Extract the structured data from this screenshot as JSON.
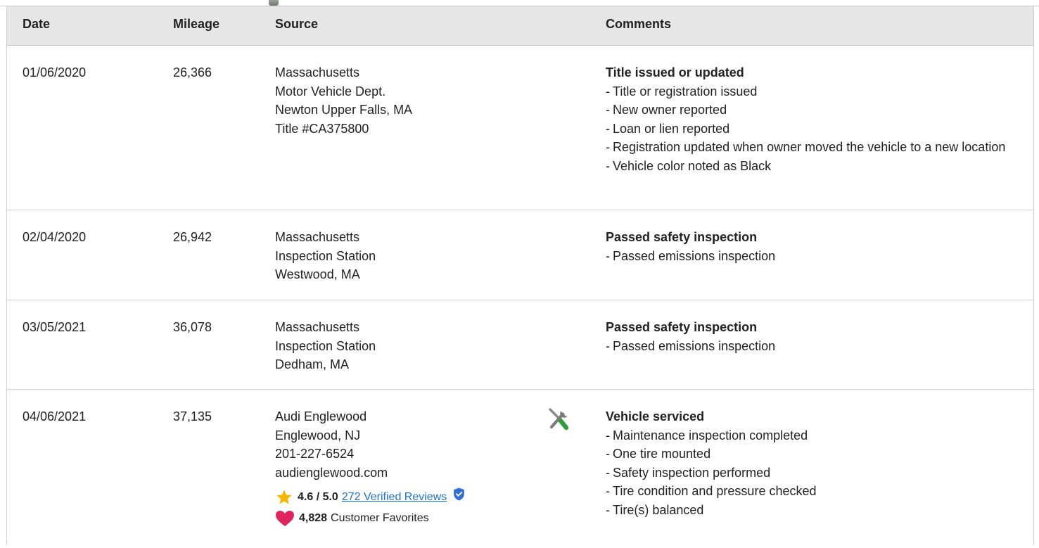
{
  "header": {
    "date": "Date",
    "mileage": "Mileage",
    "source": "Source",
    "comments": "Comments"
  },
  "rows": [
    {
      "date": "01/06/2020",
      "mileage": "26,366",
      "source": [
        "Massachusetts",
        "Motor Vehicle Dept.",
        "Newton Upper Falls, MA",
        "Title #CA375800"
      ],
      "comment_title": "Title issued or updated",
      "comments": [
        "Title or registration issued",
        "New owner reported",
        "Loan or lien reported",
        "Registration updated when owner moved the vehicle to a new location",
        "Vehicle color noted as Black"
      ]
    },
    {
      "date": "02/04/2020",
      "mileage": "26,942",
      "source": [
        "Massachusetts",
        "Inspection Station",
        "Westwood, MA"
      ],
      "comment_title": "Passed safety inspection",
      "comments": [
        "Passed emissions inspection"
      ]
    },
    {
      "date": "03/05/2021",
      "mileage": "36,078",
      "source": [
        "Massachusetts",
        "Inspection Station",
        "Dedham, MA"
      ],
      "comment_title": "Passed safety inspection",
      "comments": [
        "Passed emissions inspection"
      ]
    },
    {
      "date": "04/06/2021",
      "mileage": "37,135",
      "source": [
        "Audi Englewood",
        "Englewood, NJ",
        "201-227-6524",
        "audienglewood.com"
      ],
      "rating": "4.6 / 5.0",
      "reviews_link": "272 Verified Reviews",
      "favorites_count": "4,828",
      "favorites_label": "Customer Favorites",
      "comment_title": "Vehicle serviced",
      "comments": [
        "Maintenance inspection completed",
        "One tire mounted",
        "Safety inspection performed",
        "Tire condition and pressure checked",
        "Tire(s) balanced"
      ]
    }
  ],
  "colors": {
    "header_bg": "#e6e6e6",
    "link": "#1a73d9",
    "star": "#f5b800",
    "heart": "#e0245e",
    "verified": "#2f6fd6",
    "tool_gray": "#7a7a7a",
    "tool_green": "#2e9e3c"
  },
  "icons": {
    "service": "wrench-screwdriver-icon",
    "rating": "star-icon",
    "verified": "verified-shield-icon",
    "favorites": "heart-icon"
  }
}
